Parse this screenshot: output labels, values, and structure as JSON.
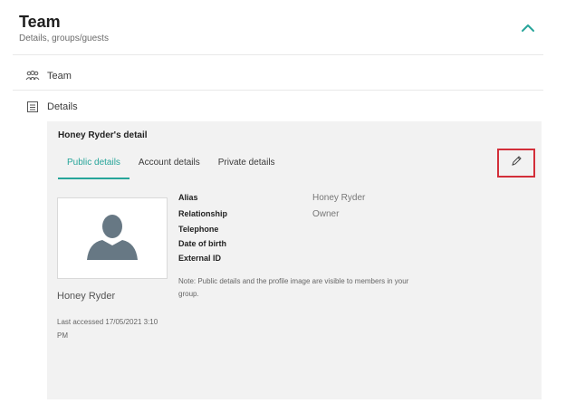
{
  "header": {
    "title": "Team",
    "subtitle": "Details, groups/guests",
    "collapse_icon": "chevron-up-icon"
  },
  "colors": {
    "accent": "#27a59a",
    "highlight_border": "#d32f3a",
    "panel_bg": "#f2f2f2"
  },
  "nav": [
    {
      "label": "Team",
      "icon": "team-icon"
    },
    {
      "label": "Details",
      "icon": "list-icon"
    }
  ],
  "detail": {
    "title": "Honey Ryder's detail",
    "tabs": [
      {
        "label": "Public details",
        "active": true
      },
      {
        "label": "Account details",
        "active": false
      },
      {
        "label": "Private details",
        "active": false
      }
    ],
    "edit_icon": "pencil-icon",
    "avatar_icon": "person-silhouette-icon",
    "name": "Honey Ryder",
    "last_accessed": "Last accessed 17/05/2021 3:10 PM",
    "fields": [
      {
        "label": "Alias",
        "value": "Honey Ryder"
      },
      {
        "label": "Relationship",
        "value": "Owner"
      },
      {
        "label": "Telephone",
        "value": ""
      },
      {
        "label": "Date of birth",
        "value": ""
      },
      {
        "label": "External ID",
        "value": ""
      }
    ],
    "note": "Note: Public details and the profile image are visible to members in your group."
  }
}
